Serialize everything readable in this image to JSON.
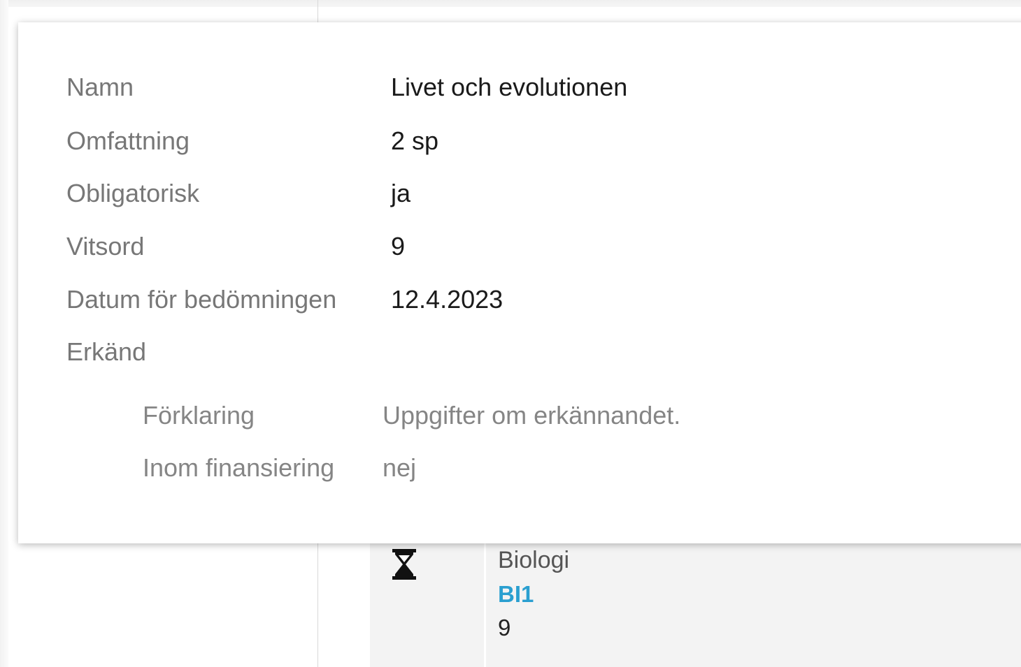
{
  "details": {
    "name_label": "Namn",
    "name_value": "Livet och evolutionen",
    "scope_label": "Omfattning",
    "scope_value": "2 sp",
    "mandatory_label": "Obligatorisk",
    "mandatory_value": "ja",
    "grade_label": "Vitsord",
    "grade_value": "9",
    "date_label": "Datum för bedömningen",
    "date_value": "12.4.2023",
    "recognized_label": "Erkänd",
    "recognized": {
      "explanation_label": "Förklaring",
      "explanation_value": "Uppgifter om erkännandet.",
      "funding_label": "Inom finansiering",
      "funding_value": "nej"
    }
  },
  "course_cell": {
    "icon": "hourglass-icon",
    "name": "Biologi",
    "code": "BI1",
    "grade": "9",
    "code_color": "#2a9fd0"
  }
}
